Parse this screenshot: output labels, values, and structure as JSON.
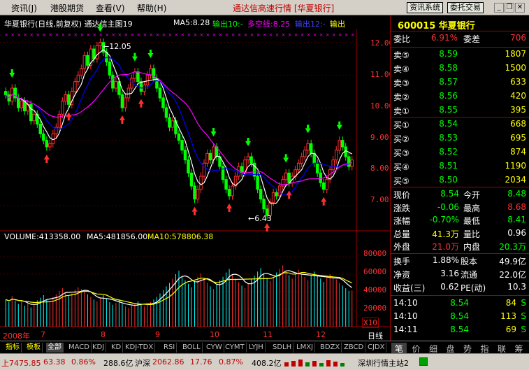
{
  "menu": [
    "资讯(J)",
    "港股期货",
    "查看(V)",
    "帮助(H)"
  ],
  "app_title": "通达信高速行情 [华夏银行]",
  "sys_buttons": [
    "资讯系统",
    "委托交易"
  ],
  "chart": {
    "title": "华夏银行(日线,前复权) 通达信主图19",
    "ma5": "MA5:8.28",
    "out10": "输出10:-",
    "duokong": "多空线:8.25",
    "out12": "输出12:-",
    "out_last": "输出",
    "price_ticks": [
      "12.00",
      "11.00",
      "10.00",
      "9.00",
      "8.00",
      "7.00"
    ],
    "high_label": "12.05",
    "low_label": "6.43",
    "volume_header": "VOLUME:413358.00",
    "vol_ma5": "MA5:481856.00",
    "vol_ma10": "MA10:578806.38",
    "vol_ticks": [
      "80000",
      "60000",
      "40000",
      "20000"
    ],
    "vol_unit": "X10",
    "x_labels": [
      "2008年",
      "7",
      "8",
      "9",
      "10",
      "11",
      "12"
    ],
    "x_right": "日线"
  },
  "chart_data": {
    "type": "candlestick",
    "title": "华夏银行(日线,前复权)",
    "ylim": [
      6.4,
      12.4
    ],
    "close_series": [
      10.4,
      10.2,
      10.6,
      10.3,
      10.0,
      10.2,
      9.9,
      10.1,
      9.6,
      9.8,
      9.5,
      9.2,
      9.0,
      8.8,
      8.9,
      9.2,
      9.4,
      9.8,
      10.2,
      10.4,
      10.1,
      10.5,
      10.8,
      11.0,
      11.2,
      11.6,
      11.3,
      11.8,
      11.5,
      11.9,
      12.0,
      11.7,
      11.4,
      11.0,
      10.6,
      10.8,
      10.4,
      10.0,
      10.3,
      10.6,
      10.9,
      11.1,
      10.8,
      10.5,
      10.7,
      11.0,
      11.2,
      10.9,
      10.6,
      10.3,
      10.0,
      9.7,
      9.4,
      9.6,
      9.2,
      9.0,
      8.7,
      8.4,
      8.0,
      7.6,
      7.2,
      7.5,
      7.9,
      8.3,
      8.6,
      8.4,
      8.8,
      8.5,
      8.2,
      7.8,
      7.5,
      7.3,
      7.6,
      7.9,
      8.2,
      8.0,
      8.4,
      8.5,
      8.3,
      7.9,
      7.5,
      7.2,
      6.9,
      6.7,
      7.1,
      7.4,
      7.3,
      7.6,
      7.8,
      8.0,
      7.7,
      7.9,
      8.1,
      8.3,
      8.5,
      8.7,
      8.9,
      8.6,
      8.3,
      8.0,
      7.7,
      7.5,
      7.8,
      8.1,
      8.4,
      8.7,
      9.0,
      8.8,
      8.5,
      8.2,
      8.4
    ],
    "volume_series": [
      31000,
      28000,
      35000,
      30000,
      26000,
      29000,
      24000,
      27000,
      22000,
      25000,
      30000,
      33000,
      36000,
      31000,
      28000,
      34000,
      37000,
      41000,
      44000,
      39000,
      35000,
      38000,
      42000,
      45000,
      43000,
      40000,
      37000,
      34000,
      31000,
      29000,
      33000,
      36000,
      32000,
      28000,
      25000,
      27000,
      30000,
      26000,
      23000,
      21000,
      24000,
      27000,
      29000,
      26000,
      23000,
      25000,
      28000,
      31000,
      34000,
      38000,
      42000,
      46000,
      50000,
      55000,
      60000,
      64000,
      58000,
      53000,
      49000,
      45000,
      52000,
      57000,
      61000,
      55000,
      50000,
      46000,
      43000,
      48000,
      53000,
      57000,
      62000,
      66000,
      60000,
      55000,
      51000,
      47000,
      44000,
      49000,
      54000,
      58000,
      63000,
      67000,
      61000,
      56000,
      52000,
      57000,
      62000,
      66000,
      70000,
      64000,
      59000,
      55000,
      60000,
      65000,
      61000,
      57000,
      53000,
      58000,
      63000,
      59000,
      55000,
      51000,
      56000,
      60000,
      57000,
      54000,
      50000,
      47000,
      44000,
      41000,
      41336
    ]
  },
  "quote": {
    "code_name": "600015 华夏银行",
    "weibi_label": "委比",
    "weibi": "6.91%",
    "weicha_label": "委差",
    "weicha": "706",
    "asks": [
      {
        "label": "卖⑤",
        "price": "8.59",
        "vol": "1807"
      },
      {
        "label": "卖④",
        "price": "8.58",
        "vol": "1500"
      },
      {
        "label": "卖③",
        "price": "8.57",
        "vol": "633"
      },
      {
        "label": "卖②",
        "price": "8.56",
        "vol": "420"
      },
      {
        "label": "卖①",
        "price": "8.55",
        "vol": "395"
      }
    ],
    "bids": [
      {
        "label": "买①",
        "price": "8.54",
        "vol": "668"
      },
      {
        "label": "买②",
        "price": "8.53",
        "vol": "695"
      },
      {
        "label": "买③",
        "price": "8.52",
        "vol": "874"
      },
      {
        "label": "买④",
        "price": "8.51",
        "vol": "1190"
      },
      {
        "label": "买⑤",
        "price": "8.50",
        "vol": "2034"
      }
    ],
    "stats": [
      {
        "l1": "现价",
        "v1": "8.54",
        "l2": "今开",
        "v2": "8.48",
        "c1": "#00ff00",
        "c2": "#00ff00"
      },
      {
        "l1": "涨跌",
        "v1": "-0.06",
        "l2": "最高",
        "v2": "8.68",
        "c1": "#00ff00",
        "c2": "#ff3030"
      },
      {
        "l1": "涨幅",
        "v1": "-0.70%",
        "l2": "最低",
        "v2": "8.41",
        "c1": "#00ff00",
        "c2": "#00ff00"
      },
      {
        "l1": "总量",
        "v1": "41.3万",
        "l2": "量比",
        "v2": "0.96",
        "c1": "#ffff00",
        "c2": "#ffffff"
      },
      {
        "l1": "外盘",
        "v1": "21.0万",
        "l2": "内盘",
        "v2": "20.3万",
        "c1": "#ff3030",
        "c2": "#00ff00"
      }
    ],
    "stats2": [
      {
        "l1": "换手",
        "v1": "1.88%",
        "l2": "股本",
        "v2": "49.9亿"
      },
      {
        "l1": "净资",
        "v1": "3.16",
        "l2": "流通",
        "v2": "22.0亿"
      },
      {
        "l1": "收益(三)",
        "v1": "0.62",
        "l2": "PE(动)",
        "v2": "10.3"
      }
    ],
    "ticks": [
      {
        "time": "14:10",
        "price": "8.54",
        "vol": "84",
        "bs": "S"
      },
      {
        "time": "14:10",
        "price": "8.54",
        "vol": "113",
        "bs": "S"
      },
      {
        "time": "14:11",
        "price": "8.54",
        "vol": "69",
        "bs": "S"
      }
    ]
  },
  "bottom_tabs": [
    "指标",
    "模板",
    "全部",
    "MACD",
    "KDJ",
    "KD",
    "KDJ-TDX",
    "RSI",
    "BOLL",
    "CYW",
    "CYMT",
    "LYJH",
    "SDLH",
    "LMXJ",
    "BDZX",
    "ZBCD",
    "CJDX"
  ],
  "right_tabs": [
    "笔",
    "价",
    "细",
    "盘",
    "势",
    "指",
    "联",
    "筹"
  ],
  "status": {
    "sh_index": "上7475.85",
    "sh_change": "63.38",
    "sh_pct": "0.86%",
    "sh_amount": "288.6亿",
    "hs_name": "沪深",
    "hs_index": "2062.86",
    "hs_change": "17.76",
    "hs_pct": "0.87%",
    "hs_amount": "408.2亿",
    "server": "深圳行情主站2"
  }
}
